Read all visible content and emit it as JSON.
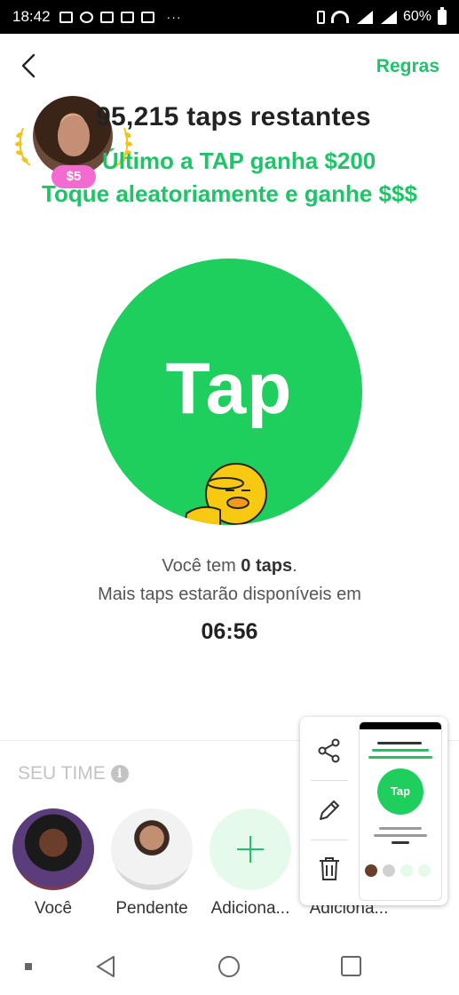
{
  "status_bar": {
    "time": "18:42",
    "battery": "60%",
    "more_notifications": "···",
    "icons": [
      "gallery-icon",
      "duck-icon",
      "instagram-icon",
      "mail-icon",
      "mail-icon",
      "vibrate-icon",
      "wifi-icon",
      "signal-icon",
      "signal-icon",
      "battery-icon"
    ]
  },
  "header": {
    "back_icon": "chevron-left-icon",
    "rules_label": "Regras"
  },
  "game": {
    "prize_badge": "$5",
    "taps_remaining": "95,215 taps restantes",
    "last_tap_wins": "Último a TAP ganha $200",
    "random_tap": "Toque aleatoriamente e ganhe $$$",
    "tap_button_label": "Tap",
    "you_have_prefix": "Você tem ",
    "you_have_count": "0 taps",
    "you_have_suffix": ".",
    "more_taps": "Mais taps estarão disponíveis em",
    "countdown": "06:56"
  },
  "team": {
    "title": "SEU TIME",
    "info_icon": "i",
    "members": [
      {
        "label": "Você"
      },
      {
        "label": "Pendente"
      },
      {
        "label": "Adiciona..."
      },
      {
        "label": "Adiciona..."
      }
    ]
  },
  "screenshot_toolbar": {
    "thumbnail_tap_label": "Tap",
    "tools": [
      "share-icon",
      "edit-icon",
      "delete-icon"
    ]
  },
  "colors": {
    "accent_green": "#1dc468",
    "tap_circle": "#1ecf5e",
    "badge_pink": "#f36bd1",
    "muted_gray": "#c3c3c3"
  }
}
